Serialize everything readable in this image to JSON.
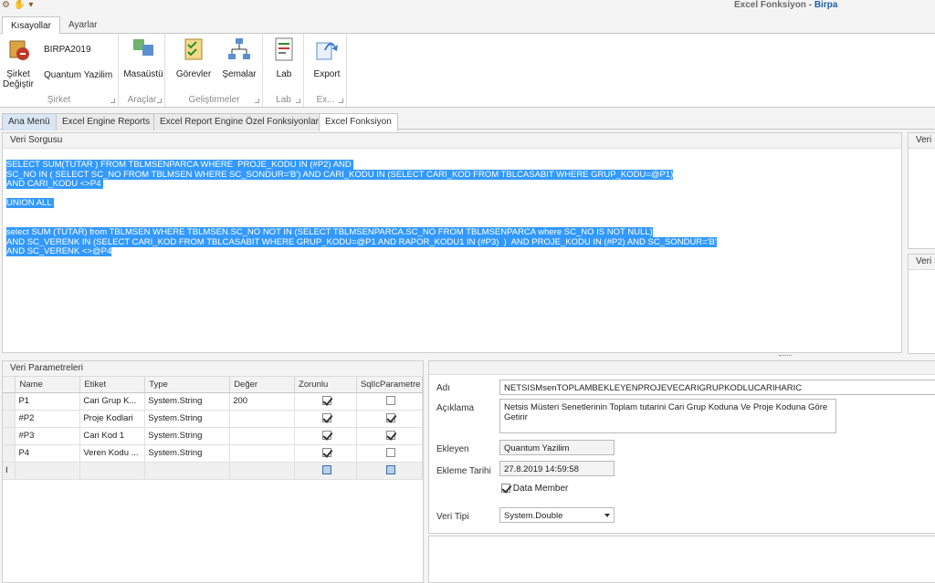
{
  "titlebar": {
    "title_prefix": "Excel Fonksiyon - ",
    "title_app": "Birpa"
  },
  "ribbon_tabs": [
    "Kısayollar",
    "Ayarlar"
  ],
  "ribbon": {
    "sirket_change": "Şirket\nDeğiştir",
    "company": "BIRPA2019",
    "user": "Quantum Yazilim",
    "masaustu": "Masaüstü",
    "gorevler": "Görevler",
    "semalar": "Şemalar",
    "lab": "Lab",
    "export": "Export",
    "groups": [
      "Şirket",
      "Araçlar",
      "Geliştirmeler",
      "Lab",
      "Ex..."
    ]
  },
  "doc_tabs": [
    "Ana Menü",
    "Excel Engine Reports",
    "Excel Report Engine Özel Fonksiyonlar",
    "Excel Fonksiyon"
  ],
  "query_panel": {
    "title": "Veri Sorgusu",
    "lines": [
      "SELECT SUM(TUTAR ) FROM TBLMSENPARCA WHERE  PROJE_KODU IN (#P2) AND ",
      "SC_NO IN ( SELECT SC_NO FROM TBLMSEN WHERE SC_SONDUR='B') AND CARI_KODU IN (SELECT CARI_KOD FROM TBLCASABIT WHERE GRUP_KODU=@P1)",
      "AND CARI_KODU <>P4 ",
      "",
      "UNION ALL ",
      "",
      "",
      "select SUM (TUTAR) from TBLMSEN WHERE TBLMSEN.SC_NO NOT IN (SELECT TBLMSENPARCA.SC_NO FROM TBLMSENPARCA where SC_NO IS NOT NULL)",
      "AND SC_VERENK IN (SELECT CARI_KOD FROM TBLCASABIT WHERE GRUP_KODU=@P1 AND RAPOR_KODU1 IN (#P3)  )  AND PROJE_KODU IN (#P2) AND SC_SONDUR='B'",
      "AND SC_VERENK <>@P4"
    ]
  },
  "side_panels": [
    "Veri S",
    "Veri S"
  ],
  "params_panel": {
    "title": "Veri Parametreleri",
    "columns": [
      "Name",
      "Etiket",
      "Type",
      "Değer",
      "Zorunlu",
      "SqlIcParametre"
    ],
    "rows": [
      {
        "name": "P1",
        "etiket": "Cari Grup K...",
        "type": "System.String",
        "deger": "200",
        "zorunlu": true,
        "sqlic": false
      },
      {
        "name": "#P2",
        "etiket": "Proje Kodlari",
        "type": "System.String",
        "deger": "",
        "zorunlu": true,
        "sqlic": true
      },
      {
        "name": "#P3",
        "etiket": "Cari Kod 1",
        "type": "System.String",
        "deger": "",
        "zorunlu": true,
        "sqlic": true
      },
      {
        "name": "P4",
        "etiket": "Veren Kodu ...",
        "type": "System.String",
        "deger": "",
        "zorunlu": true,
        "sqlic": false
      }
    ]
  },
  "props": {
    "adi_label": "Adı",
    "adi": "NETSISMsenTOPLAMBEKLEYENPROJEVECARIGRUPKODLUCARIHARIC",
    "aciklama_label": "Açıklama",
    "aciklama": "Netsis Müsteri Senetlerinin Toplam tutarini Cari Grup Koduna Ve Proje Koduna Göre Getirir",
    "ekleyen_label": "Ekleyen",
    "ekleyen": "Quantum Yazilim",
    "ekleme_label": "Ekleme Tarihi",
    "ekleme": "27.8.2019 14:59:58",
    "data_member": "Data Member",
    "veri_tipi_label": "Veri Tipi",
    "veri_tipi": "System.Double"
  },
  "colors": {
    "selection": "#3399ff",
    "accent": "#1e5fa8"
  }
}
